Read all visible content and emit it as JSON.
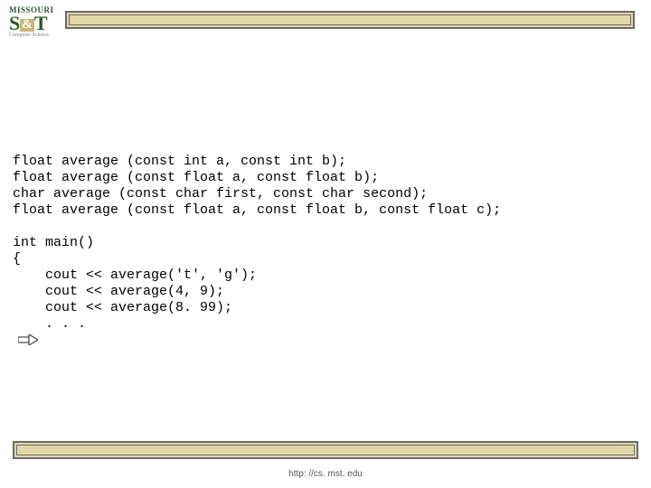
{
  "logo": {
    "line1": "MISSOURI",
    "main": "S&T",
    "sub": "Computer Science"
  },
  "code": {
    "l1": "float average (const int a, const int b);",
    "l2": "float average (const float a, const float b);",
    "l3": "char average (const char first, const char second);",
    "l4": "float average (const float a, const float b, const float c);",
    "l5": "",
    "l6": "int main()",
    "l7": "{",
    "l8": "    cout << average('t', 'g');",
    "l9": "    cout << average(4, 9);",
    "l10": "    cout << average(8. 99);",
    "l11": "    . . ."
  },
  "footer": {
    "url": "http: //cs. mst. edu"
  }
}
